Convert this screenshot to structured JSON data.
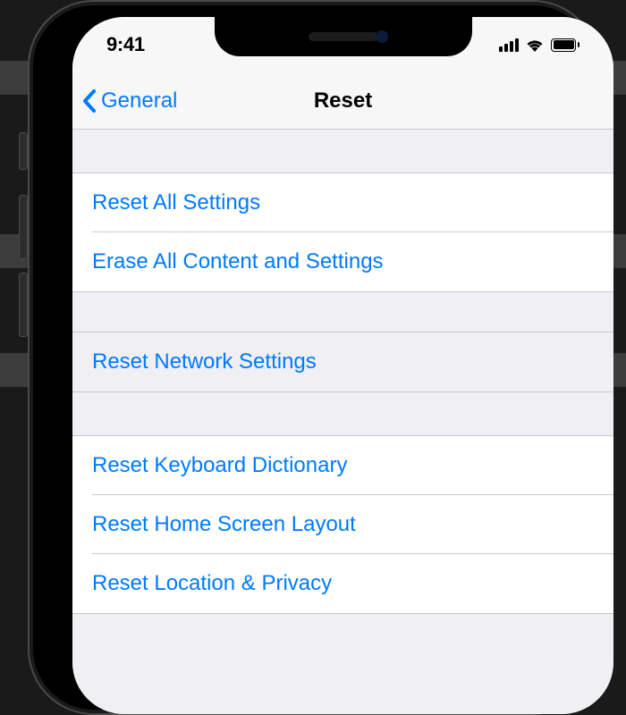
{
  "status": {
    "time": "9:41"
  },
  "nav": {
    "back_label": "General",
    "title": "Reset"
  },
  "sections": {
    "group1": {
      "reset_all": "Reset All Settings",
      "erase_all": "Erase All Content and Settings"
    },
    "group2": {
      "reset_network": "Reset Network Settings"
    },
    "group3": {
      "reset_keyboard": "Reset Keyboard Dictionary",
      "reset_home": "Reset Home Screen Layout",
      "reset_location": "Reset Location & Privacy"
    }
  },
  "colors": {
    "link": "#007aff",
    "bg": "#efeff4",
    "separator": "#c8c7cc"
  }
}
